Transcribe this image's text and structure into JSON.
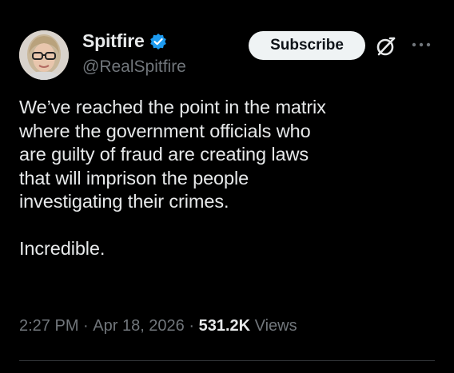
{
  "author": {
    "display_name": "Spitfire",
    "handle": "@RealSpitfire",
    "verified": true
  },
  "actions": {
    "subscribe_label": "Subscribe"
  },
  "post": {
    "text": "We’ve reached the point in the matrix\nwhere the government officials who\nare guilty of fraud are creating laws\nthat will imprison the people\ninvestigating their crimes.\n\nIncredible.",
    "time": "2:27 PM",
    "separator": " · ",
    "date": "Apr 18, 2026",
    "views_count": "531.2K",
    "views_label": " Views"
  },
  "colors": {
    "background": "#000000",
    "text_primary": "#e7e9ea",
    "text_secondary": "#71767b",
    "verified_blue": "#1d9bf0",
    "button_bg": "#eff3f4"
  },
  "icons": {
    "verified": "verified-badge-icon",
    "grok": "grok-icon",
    "more": "more-options-icon"
  }
}
